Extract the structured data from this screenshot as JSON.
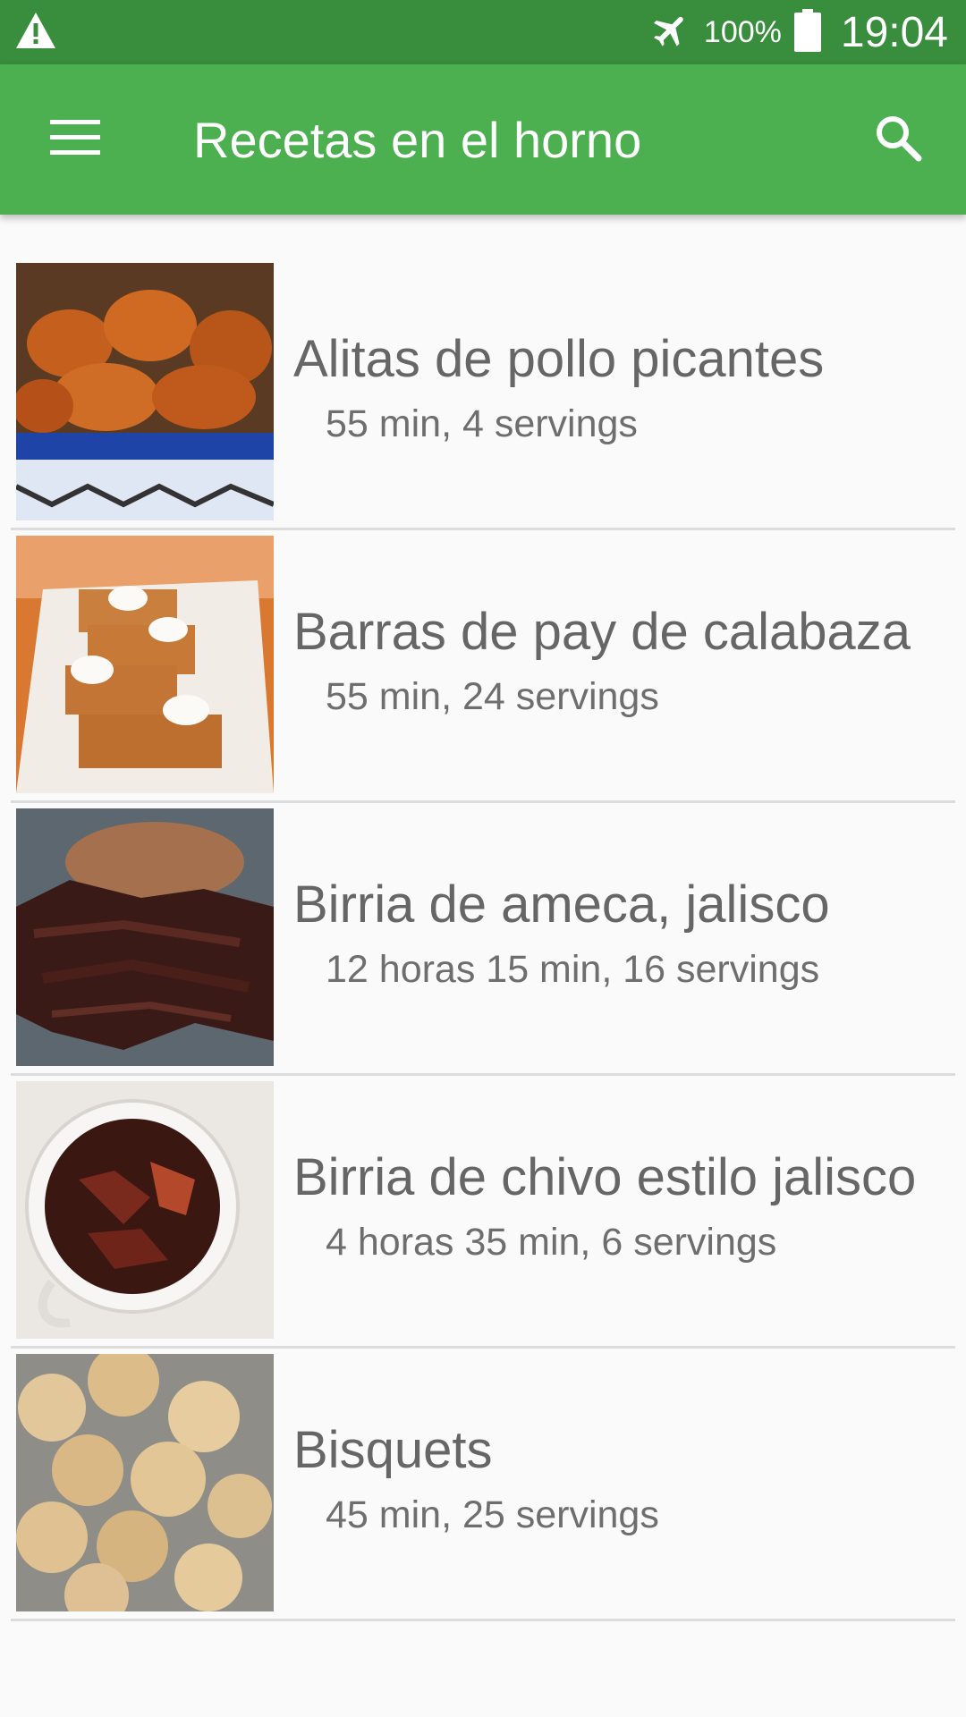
{
  "status_bar": {
    "battery_percent": "100%",
    "time": "19:04",
    "icons": [
      "warning-icon",
      "airplane-mode-icon",
      "battery-icon"
    ]
  },
  "app_bar": {
    "title": "Recetas en el horno",
    "icons": [
      "menu-icon",
      "search-icon"
    ],
    "color": "#4caf50",
    "status_color": "#388e3c"
  },
  "recipes": [
    {
      "name": "Alitas de pollo picantes",
      "meta": "55 min, 4 servings"
    },
    {
      "name": "Barras de pay de calabaza",
      "meta": "55 min, 24 servings"
    },
    {
      "name": "Birria de ameca, jalisco",
      "meta": "12 horas 15 min, 16 servings"
    },
    {
      "name": "Birria de chivo estilo jalisco",
      "meta": "4 horas 35 min, 6 servings"
    },
    {
      "name": "Bisquets",
      "meta": "45 min, 25 servings"
    }
  ]
}
